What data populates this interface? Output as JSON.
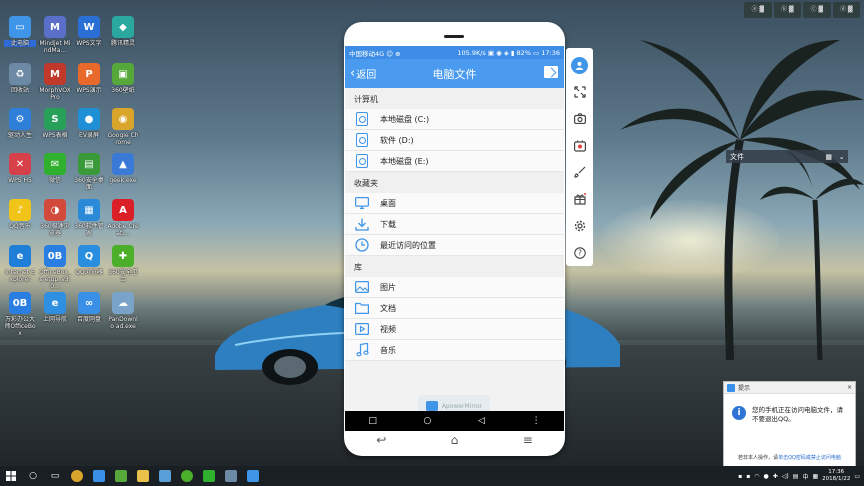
{
  "desktop": {
    "icons": [
      {
        "label": "此电脑",
        "color": "#3f95e8",
        "glyph": "▭",
        "selected": true
      },
      {
        "label": "Mindjet MindMa...",
        "color": "#5a6fc9",
        "glyph": "M"
      },
      {
        "label": "WPS文字",
        "color": "#2a6fd6",
        "glyph": "W"
      },
      {
        "label": "腾讯精灵",
        "color": "#2aa8a0",
        "glyph": "◆"
      },
      {
        "label": "回收站",
        "color": "#6c8aa6",
        "glyph": "♻"
      },
      {
        "label": "MorphVOX Pro",
        "color": "#c0392b",
        "glyph": "M"
      },
      {
        "label": "WPS演示",
        "color": "#e8692a",
        "glyph": "P"
      },
      {
        "label": "360壁纸",
        "color": "#57a83a",
        "glyph": "▣"
      },
      {
        "label": "驱动人生",
        "color": "#2f7ed8",
        "glyph": "⚙"
      },
      {
        "label": "WPS表格",
        "color": "#27a159",
        "glyph": "S"
      },
      {
        "label": "EV录屏",
        "color": "#1f8fd6",
        "glyph": "●"
      },
      {
        "label": "Google Chrome",
        "color": "#d9a52b",
        "glyph": "◉"
      },
      {
        "label": "WPS H5",
        "color": "#d6404a",
        "glyph": "✕"
      },
      {
        "label": "微信",
        "color": "#2fb02f",
        "glyph": "✉"
      },
      {
        "label": "360安全桌面",
        "color": "#3a9a3a",
        "glyph": "▤"
      },
      {
        "label": "geek.exe",
        "color": "#3a7ad6",
        "glyph": "▲"
      },
      {
        "label": "QQ音乐",
        "color": "#f0c419",
        "glyph": "♪"
      },
      {
        "label": "360极速浏览器",
        "color": "#d24a3c",
        "glyph": "◑"
      },
      {
        "label": "360软件管家",
        "color": "#2b8ad8",
        "glyph": "▦"
      },
      {
        "label": "Adobe Creati...",
        "color": "#da1f26",
        "glyph": "A"
      },
      {
        "label": "Internet Explorer",
        "color": "#1f7fd8",
        "glyph": "e"
      },
      {
        "label": "OfficeBox_s etup_v3.0...",
        "color": "#2a7de1",
        "glyph": "0B"
      },
      {
        "label": "QQ浏览器",
        "color": "#2a8ee0",
        "glyph": "Q"
      },
      {
        "label": "360安全卫士",
        "color": "#4caf2a",
        "glyph": "✚"
      },
      {
        "label": "万彩办公大师OfficeBox",
        "color": "#2a7de1",
        "glyph": "0B"
      },
      {
        "label": "上网导航",
        "color": "#2f8fe0",
        "glyph": "e"
      },
      {
        "label": "百度网盘",
        "color": "#3a8fe6",
        "glyph": "∞"
      },
      {
        "label": "PanDownlo ad.exe",
        "color": "#7aa3c9",
        "glyph": "☁"
      }
    ]
  },
  "explorer_search": {
    "label": "文件"
  },
  "phone": {
    "status": {
      "left": "中国移动4G ☺ ⊕",
      "right": "105.9K/s ▣ ◉ ◈ ▮ 82% ▭ 17:36"
    },
    "app": {
      "back_label": "返回",
      "title": "电脑文件",
      "sections": [
        {
          "title": "计算机",
          "items": [
            {
              "label": "本地磁盘 (C:)",
              "icon": "disk-icon"
            },
            {
              "label": "软件 (D:)",
              "icon": "disk-icon"
            },
            {
              "label": "本地磁盘 (E:)",
              "icon": "disk-icon"
            }
          ]
        },
        {
          "title": "收藏夹",
          "items": [
            {
              "label": "桌面",
              "icon": "desktop-icon"
            },
            {
              "label": "下载",
              "icon": "download-icon"
            },
            {
              "label": "最近访问的位置",
              "icon": "clock-icon"
            }
          ]
        },
        {
          "title": "库",
          "items": [
            {
              "label": "图片",
              "icon": "image-icon"
            },
            {
              "label": "文档",
              "icon": "folder-icon"
            },
            {
              "label": "视频",
              "icon": "video-icon"
            },
            {
              "label": "音乐",
              "icon": "music-icon"
            }
          ]
        }
      ]
    },
    "watermark": "ApowerMirror",
    "navbar": {
      "square": "□",
      "circle": "○",
      "back": "◁",
      "more": "⋮"
    },
    "hwkeys": {
      "back": "↩",
      "home": "⌂",
      "menu": "≡"
    }
  },
  "sidebar": {
    "buttons": [
      {
        "name": "avatar",
        "glyph": "👤"
      },
      {
        "name": "fullscreen-icon",
        "glyph": "⤢"
      },
      {
        "name": "screenshot-icon",
        "glyph": "◙"
      },
      {
        "name": "record-icon",
        "glyph": "▣"
      },
      {
        "name": "brush-icon",
        "glyph": "✎"
      },
      {
        "name": "gift-icon",
        "glyph": "⊞"
      },
      {
        "name": "settings-icon",
        "glyph": "⚙"
      },
      {
        "name": "help-icon",
        "glyph": "?"
      }
    ]
  },
  "notification": {
    "title": "提示",
    "message": "您的手机正在访问电脑文件，请不要退出QQ。",
    "footer_prefix": "若非本人操作，请",
    "footer_link": "单击QQ密码或禁止访问电脑"
  },
  "taskbar": {
    "clock_time": "17:36",
    "clock_date": "2018/1/22"
  },
  "topright_thumbs": [
    "ⓐ ▓",
    "ⓑ ▓",
    "ⓒ ▓",
    "ⓓ ▓"
  ]
}
